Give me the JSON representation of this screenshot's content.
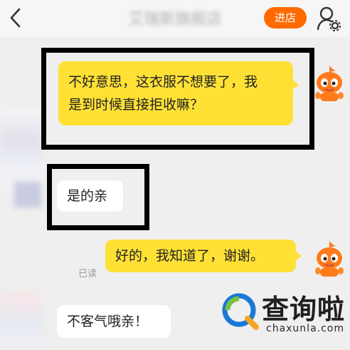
{
  "header": {
    "title": "艾瑞斯旗舰店",
    "shop_button": "进店"
  },
  "messages": [
    {
      "from": "me",
      "text_line1": "不好意思，这衣服不想要了，我",
      "text_line2": "是到时候直接拒收嘛？"
    },
    {
      "from": "other",
      "text": "是的亲"
    },
    {
      "from": "me",
      "text": "好的，我知道了，谢谢。",
      "status": "已读"
    },
    {
      "from": "other",
      "text": "不客气哦亲！"
    }
  ],
  "watermark": {
    "name": "查询啦",
    "url": "chaxunla.com"
  },
  "colors": {
    "accent": "#ff6a00",
    "my_bubble": "#ffe135",
    "other_bubble": "#ffffff",
    "frame": "#000000"
  },
  "icons": [
    "back-arrow-icon",
    "user-settings-icon",
    "mascot-avatar-icon",
    "search-logo-icon"
  ]
}
